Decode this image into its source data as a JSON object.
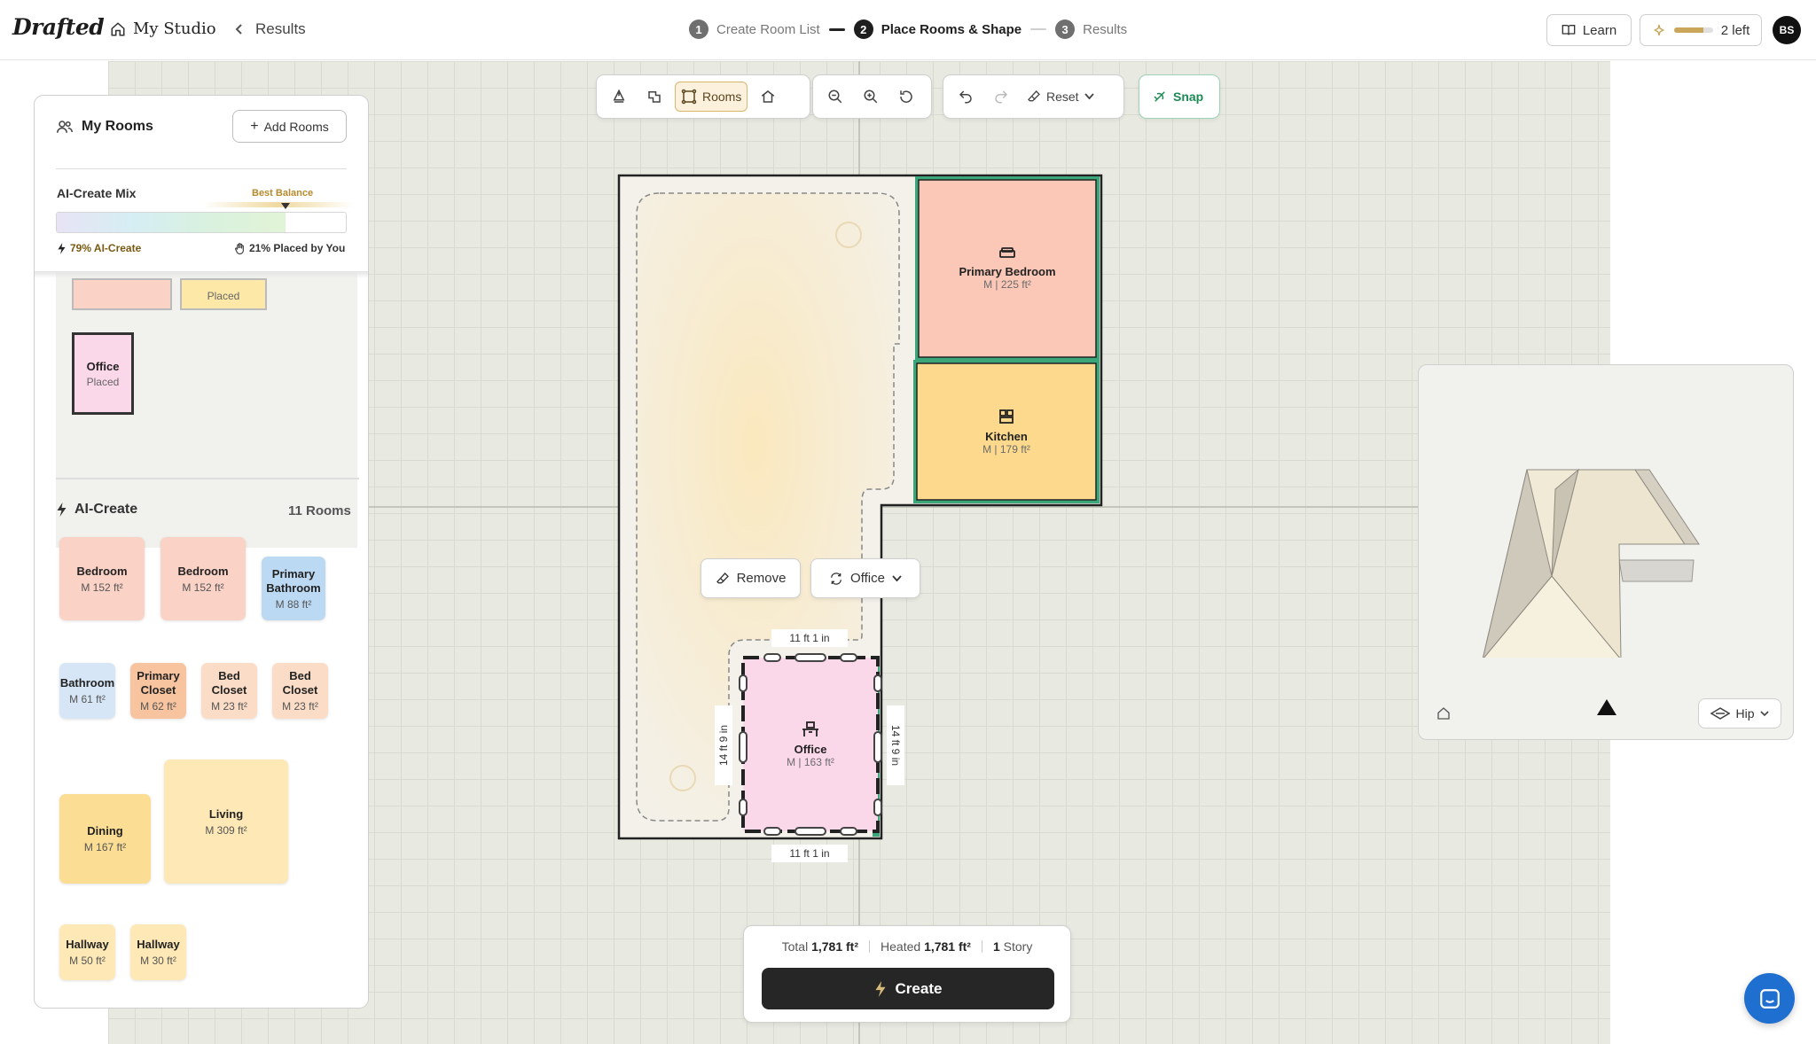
{
  "header": {
    "logo": "Drafted",
    "studio_label": "My Studio",
    "breadcrumb": "Results",
    "steps": [
      {
        "num": "1",
        "label": "Create Room List"
      },
      {
        "num": "2",
        "label": "Place Rooms & Shape"
      },
      {
        "num": "3",
        "label": "Results"
      }
    ],
    "active_step": 2,
    "learn_label": "Learn",
    "credits_label": "2 left",
    "credits_fraction": 0.75,
    "avatar_initials": "BS"
  },
  "toolbar": {
    "rooms_label": "Rooms",
    "reset_label": "Reset",
    "snap_label": "Snap",
    "icons": [
      "pen-icon",
      "shape-icon",
      "rooms-icon",
      "house-icon",
      "zoom-out-icon",
      "zoom-in-icon",
      "rotate-icon",
      "undo-icon",
      "redo-icon",
      "eraser-icon",
      "chevron-down-icon",
      "snap-icon"
    ]
  },
  "panel": {
    "title": "My Rooms",
    "add_rooms_label": "Add Rooms",
    "mix_label": "AI-Create Mix",
    "mix_best_label": "Best Balance",
    "mix_ai_fraction": 0.79,
    "mix_ai_label": "79% AI-Create",
    "mix_you_label": "21% Placed by You",
    "placed_rooms": [
      {
        "name": "",
        "status": "",
        "color": "#fbd2c6"
      },
      {
        "name": "",
        "status": "Placed",
        "color": "#fde8a8"
      },
      {
        "name": "Office",
        "status": "Placed",
        "color": "#fbd7ea"
      }
    ],
    "ai_create_label": "AI-Create",
    "ai_count_label": "11 Rooms",
    "ai_rooms": [
      {
        "name": "Bedroom",
        "size": "M 152 ft²"
      },
      {
        "name": "Bedroom",
        "size": "M 152 ft²"
      },
      {
        "name": "Primary Bathroom",
        "size": "M 88 ft²"
      },
      {
        "name": "Bathroom",
        "size": "M 61 ft²"
      },
      {
        "name": "Primary Closet",
        "size": "M 62 ft²"
      },
      {
        "name": "Bed Closet",
        "size": "M 23 ft²"
      },
      {
        "name": "Bed Closet",
        "size": "M 23 ft²"
      },
      {
        "name": "Dining",
        "size": "M 167 ft²"
      },
      {
        "name": "Living",
        "size": "M 309 ft²"
      },
      {
        "name": "Hallway",
        "size": "M 50 ft²"
      },
      {
        "name": "Hallway",
        "size": "M 30 ft²"
      }
    ]
  },
  "plan": {
    "rooms": [
      {
        "name": "Primary Bedroom",
        "size": "M | 225 ft²",
        "icon": "bed-icon"
      },
      {
        "name": "Kitchen",
        "size": "M | 179 ft²",
        "icon": "kitchen-icon"
      },
      {
        "name": "Office",
        "size": "M | 163 ft²",
        "icon": "desk-icon"
      }
    ],
    "dims": {
      "top": "11 ft 1 in",
      "bottom": "11 ft 1 in",
      "left": "14 ft 9 in",
      "right": "14 ft 9 in"
    },
    "remove_label": "Remove",
    "type_label": "Office"
  },
  "preview": {
    "roof_label": "Hip"
  },
  "summary": {
    "total_label": "Total",
    "total_value": "1,781 ft²",
    "heated_label": "Heated",
    "heated_value": "1,781 ft²",
    "story_count": "1",
    "story_label": "Story",
    "create_label": "Create"
  },
  "colors": {
    "accent": "#1d8a55",
    "primary_bedroom": "#fbc8b7",
    "kitchen": "#fcd98c",
    "office": "#fbd7ea",
    "snap_border": "#9fd3b7",
    "create_bg": "#262626"
  }
}
